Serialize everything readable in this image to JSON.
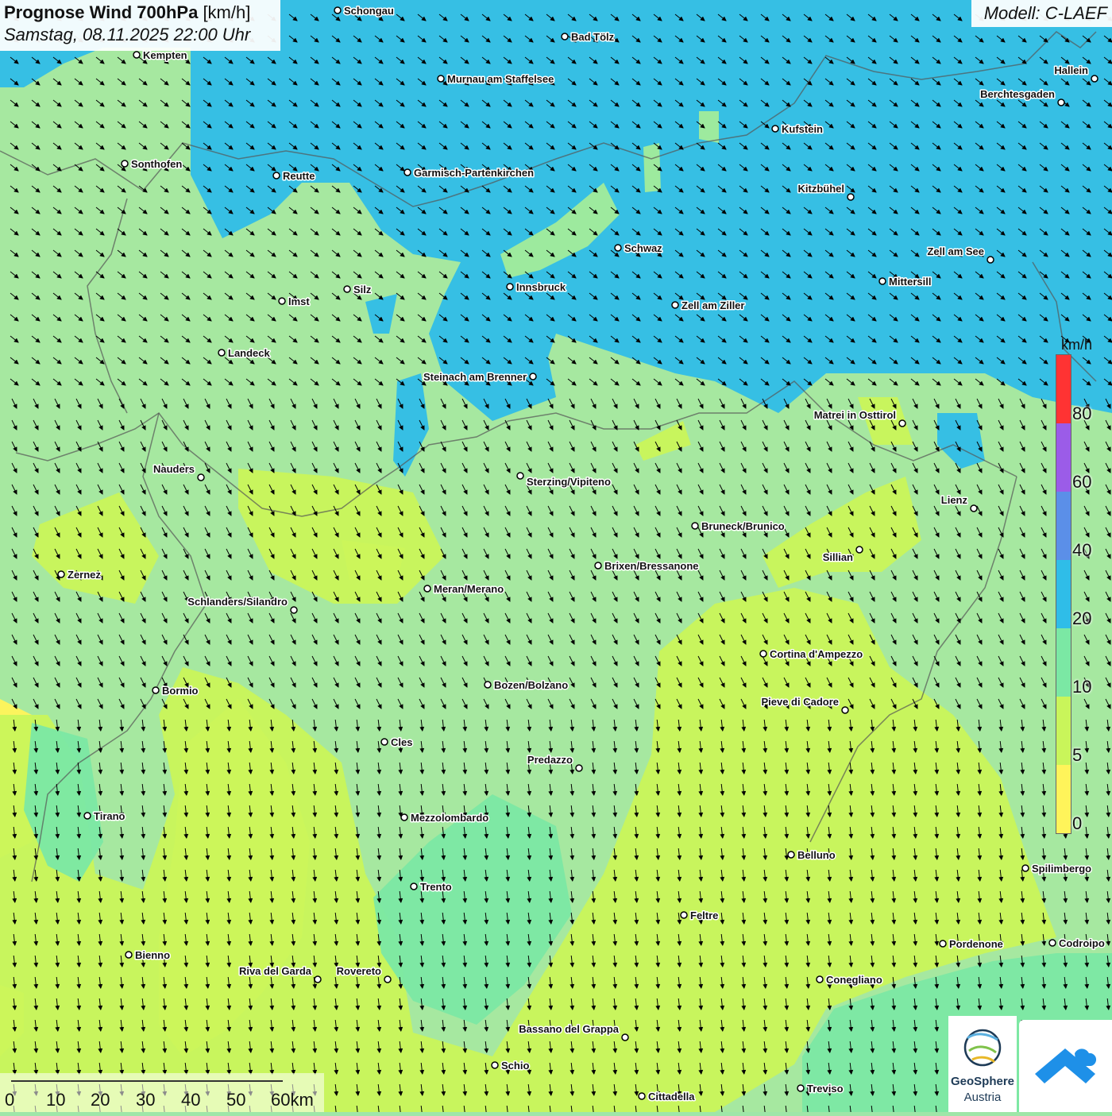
{
  "header": {
    "title_bold": "Prognose Wind 700hPa",
    "title_unit": "[km/h]",
    "datetime": "Samstag, 08.11.2025 22:00 Uhr",
    "model": "Modell: C-LAEF"
  },
  "legend": {
    "unit": "km/h",
    "labels": [
      "80",
      "60",
      "40",
      "20",
      "10",
      "5",
      "0"
    ],
    "colors": {
      "very_high": "#ff3333",
      "60_80": "#9b5ce8",
      "40_60": "#5b8fe8",
      "20_40": "#2fbde8",
      "10_20": "#7be8a4",
      "5_10": "#c9f55a",
      "0_5": "#fff45a"
    }
  },
  "scale": {
    "labels": [
      "0",
      "10",
      "20",
      "30",
      "40",
      "50",
      "60km"
    ]
  },
  "logos": {
    "geosphere_line1": "GeoSphere",
    "geosphere_line2": "Austria"
  },
  "cities": [
    {
      "name": "Schongau"
    },
    {
      "name": "Bad Tölz"
    },
    {
      "name": "Kempten"
    },
    {
      "name": "Murnau am Staffelsee"
    },
    {
      "name": "Hallein"
    },
    {
      "name": "Berchtesgaden"
    },
    {
      "name": "Kufstein"
    },
    {
      "name": "Sonthofen"
    },
    {
      "name": "Reutte"
    },
    {
      "name": "Garmisch-Partenkirchen"
    },
    {
      "name": "Kitzbühel"
    },
    {
      "name": "Schwaz"
    },
    {
      "name": "Zell am See"
    },
    {
      "name": "Innsbruck"
    },
    {
      "name": "Mittersill"
    },
    {
      "name": "Silz"
    },
    {
      "name": "Imst"
    },
    {
      "name": "Zell am Ziller"
    },
    {
      "name": "Landeck"
    },
    {
      "name": "Steinach am Brenner"
    },
    {
      "name": "Matrei in Osttirol"
    },
    {
      "name": "Nauders"
    },
    {
      "name": "Sterzing/Vipiteno"
    },
    {
      "name": "Lienz"
    },
    {
      "name": "Bruneck/Brunico"
    },
    {
      "name": "Sillian"
    },
    {
      "name": "Brixen/Bressanone"
    },
    {
      "name": "Zernez"
    },
    {
      "name": "Meran/Merano"
    },
    {
      "name": "Schlanders/Silandro"
    },
    {
      "name": "Cortina d'Ampezzo"
    },
    {
      "name": "Bozen/Bolzano"
    },
    {
      "name": "Bormio"
    },
    {
      "name": "Pieve di Cadore"
    },
    {
      "name": "Cles"
    },
    {
      "name": "Predazzo"
    },
    {
      "name": "Tirano"
    },
    {
      "name": "Mezzolombardo"
    },
    {
      "name": "Belluno"
    },
    {
      "name": "Spilimbergo"
    },
    {
      "name": "Trento"
    },
    {
      "name": "Feltre"
    },
    {
      "name": "Pordenone"
    },
    {
      "name": "Codroipo"
    },
    {
      "name": "Bienno"
    },
    {
      "name": "Riva del Garda"
    },
    {
      "name": "Rovereto"
    },
    {
      "name": "Conegliano"
    },
    {
      "name": "Bassano del Grappa"
    },
    {
      "name": "Schio"
    },
    {
      "name": "Treviso"
    },
    {
      "name": "Cittadella"
    }
  ]
}
